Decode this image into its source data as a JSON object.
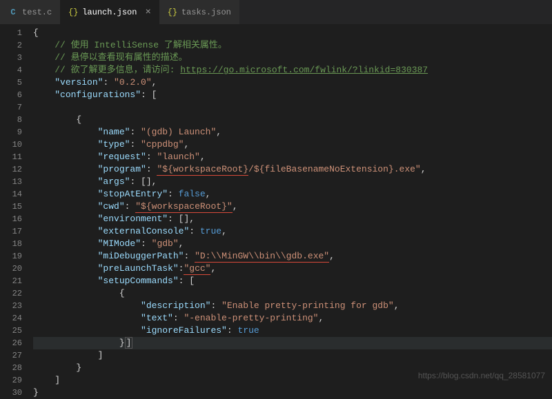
{
  "tabs": [
    {
      "icon": "C",
      "iconColor": "#519aba",
      "label": "test.c",
      "active": false,
      "closable": false
    },
    {
      "icon": "{}",
      "iconColor": "#cbcb41",
      "label": "launch.json",
      "active": true,
      "closable": true
    },
    {
      "icon": "{}",
      "iconColor": "#cbcb41",
      "label": "tasks.json",
      "active": false,
      "closable": false
    }
  ],
  "lineCount": 30,
  "watermark": "https://blog.csdn.net/qq_28581077",
  "code": {
    "comment1": "// 使用 IntelliSense 了解相关属性。",
    "comment2": "// 悬停以查看现有属性的描述。",
    "comment3a": "// 欲了解更多信息，请访问: ",
    "comment3link": "https://go.microsoft.com/fwlink/?linkid=830387",
    "version_k": "\"version\"",
    "version_v": "\"0.2.0\"",
    "config_k": "\"configurations\"",
    "name_k": "\"name\"",
    "name_v": "\"(gdb) Launch\"",
    "type_k": "\"type\"",
    "type_v": "\"cppdbg\"",
    "request_k": "\"request\"",
    "request_v": "\"launch\"",
    "program_k": "\"program\"",
    "program_v1": "\"${workspaceRoot}",
    "program_v2": "/${fileBasenameNoExtension}.exe\"",
    "args_k": "\"args\"",
    "stop_k": "\"stopAtEntry\"",
    "stop_v": "false",
    "cwd_k": "\"cwd\"",
    "cwd_v": "\"${workspaceRoot}\"",
    "env_k": "\"environment\"",
    "ext_k": "\"externalConsole\"",
    "ext_v": "true",
    "mi_k": "\"MIMode\"",
    "mi_v": "\"gdb\"",
    "midbg_k": "\"miDebuggerPath\"",
    "midbg_v": "\"D:\\\\MinGW\\\\bin\\\\gdb.exe\"",
    "pre_k": "\"preLaunchTask\"",
    "pre_v": "\"gcc\"",
    "setup_k": "\"setupCommands\"",
    "desc_k": "\"description\"",
    "desc_v": "\"Enable pretty-printing for gdb\"",
    "text_k": "\"text\"",
    "text_v": "\"-enable-pretty-printing\"",
    "ign_k": "\"ignoreFailures\"",
    "ign_v": "true"
  }
}
